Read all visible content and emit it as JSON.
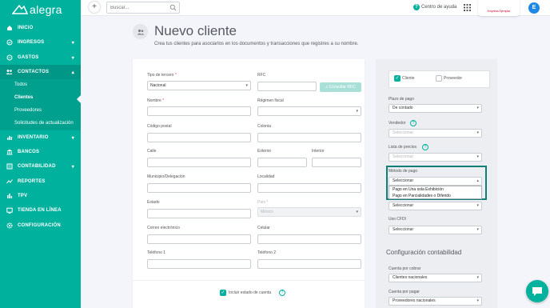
{
  "app": {
    "name": "alegra",
    "brand_color": "#00b19d"
  },
  "sidebar": {
    "items": [
      {
        "label": "INICIO",
        "icon": "home-icon"
      },
      {
        "label": "INGRESOS",
        "icon": "income-icon"
      },
      {
        "label": "GASTOS",
        "icon": "expenses-icon"
      },
      {
        "label": "CONTACTOS",
        "icon": "contacts-icon"
      },
      {
        "label": "INVENTARIO",
        "icon": "inventory-icon"
      },
      {
        "label": "BANCOS",
        "icon": "bank-icon"
      },
      {
        "label": "CONTABILIDAD",
        "icon": "accounting-icon"
      },
      {
        "label": "REPORTES",
        "icon": "reports-icon"
      },
      {
        "label": "TPV",
        "icon": "pos-icon"
      },
      {
        "label": "TIENDA EN LÍNEA",
        "icon": "store-icon"
      },
      {
        "label": "CONFIGURACIÓN",
        "icon": "settings-icon"
      }
    ],
    "contacts_sub": [
      "Todos",
      "Clientes",
      "Proveedores",
      "Solicitudes de actualización"
    ]
  },
  "topbar": {
    "search_placeholder": "Buscar...",
    "help_label": "Centro de ayuda",
    "company_logo_text": "Empresa Ejemplar",
    "avatar_initial": "E"
  },
  "page": {
    "title": "Nuevo cliente",
    "subtitle": "Crea tus clientes para asociarlos en los documentos y transacciones que registres a su nombre."
  },
  "form": {
    "tipo_tercero_label": "Tipo de tercero",
    "tipo_tercero_value": "Nacional",
    "rfc_label": "RFC",
    "consultar_rfc": "Consultar RFC",
    "nombre_label": "Nombre",
    "regimen_label": "Régimen fiscal",
    "cp_label": "Código postal",
    "colonia_label": "Colonia",
    "calle_label": "Calle",
    "exterior_label": "Exterior",
    "interior_label": "Interior",
    "municipio_label": "Municipio/Delegación",
    "localidad_label": "Localidad",
    "estado_label": "Estado",
    "pais_label": "País",
    "pais_value": "México",
    "correo_label": "Correo electrónico",
    "celular_label": "Celular",
    "telefono1_label": "Teléfono 1",
    "telefono2_label": "Teléfono 2",
    "incluir_estado_label": "Incluir estado de cuenta",
    "required_mark": "*"
  },
  "panel": {
    "cliente_label": "Cliente",
    "proveedor_label": "Proveedor",
    "plazo_label": "Plazo de pago",
    "plazo_value": "De contado",
    "vendedor_label": "Vendedor",
    "vendedor_value": "Seleccionar",
    "lista_label": "Lista de precios",
    "lista_value": "Seleccionar",
    "metodo_label": "Método de pago",
    "metodo_value": "Seleccionar",
    "metodo_options": [
      "Pago en Una sola Exhibición",
      "Pago en Parcialidades o Diferido"
    ],
    "forma_value": "Seleccionar",
    "uso_cfdi_label": "Uso CFDI",
    "uso_cfdi_value": "Seleccionar",
    "config_title": "Configuración contabilidad",
    "cxc_label": "Cuenta por cobrar",
    "cxc_value": "Clientes nacionales",
    "cxp_label": "Cuenta por pagar",
    "cxp_value": "Proveedores nacionales"
  }
}
